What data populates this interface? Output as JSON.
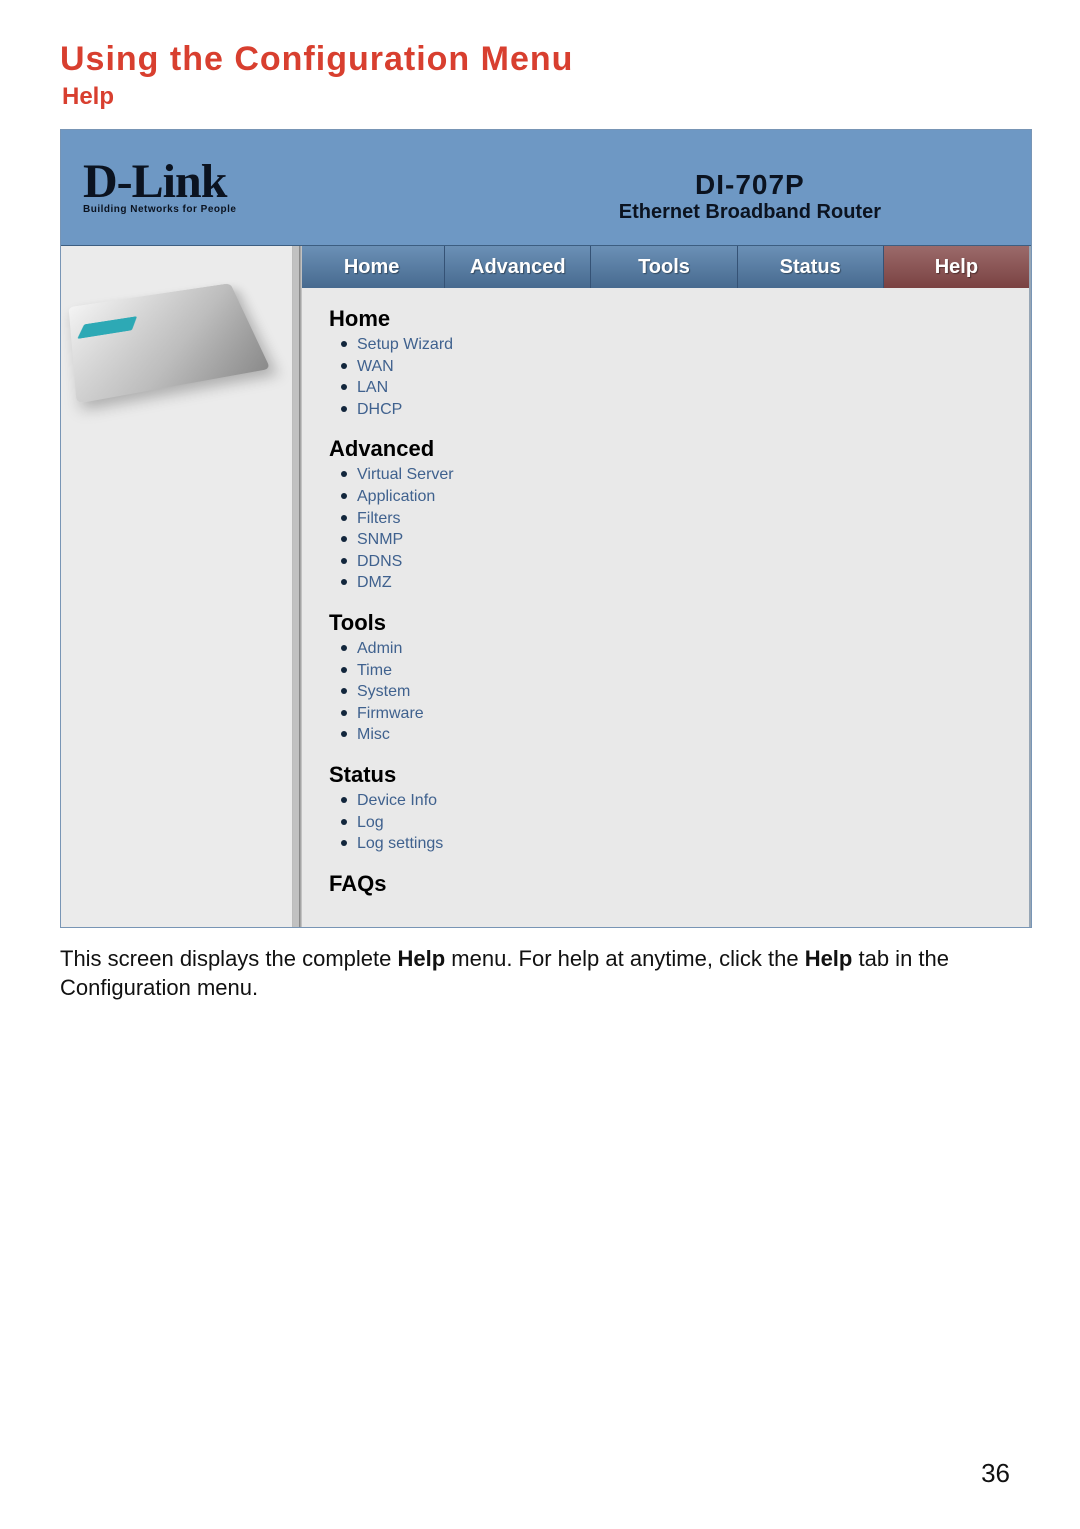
{
  "doc": {
    "title": "Using the Configuration Menu",
    "subtitle": "Help",
    "page_number": "36",
    "caption_pre": "This screen displays the complete ",
    "caption_bold1": "Help",
    "caption_mid": " menu.  For help at anytime, click the ",
    "caption_bold2": "Help",
    "caption_post": " tab in the Configuration menu."
  },
  "brand": {
    "logo": "D-Link",
    "tagline": "Building Networks for People"
  },
  "model": {
    "name": "DI-707P",
    "desc": "Ethernet Broadband Router"
  },
  "tabs": [
    {
      "label": "Home"
    },
    {
      "label": "Advanced"
    },
    {
      "label": "Tools"
    },
    {
      "label": "Status"
    },
    {
      "label": "Help"
    }
  ],
  "sections": {
    "home": {
      "title": "Home",
      "items": [
        "Setup Wizard",
        "WAN",
        "LAN",
        "DHCP"
      ]
    },
    "advanced": {
      "title": "Advanced",
      "items": [
        "Virtual Server",
        "Application",
        "Filters",
        "SNMP",
        "DDNS",
        "DMZ"
      ]
    },
    "tools": {
      "title": "Tools",
      "items": [
        "Admin",
        "Time",
        "System",
        "Firmware",
        "Misc"
      ]
    },
    "status": {
      "title": "Status",
      "items": [
        "Device Info",
        "Log",
        "Log settings"
      ]
    },
    "faqs": {
      "title": "FAQs"
    }
  }
}
